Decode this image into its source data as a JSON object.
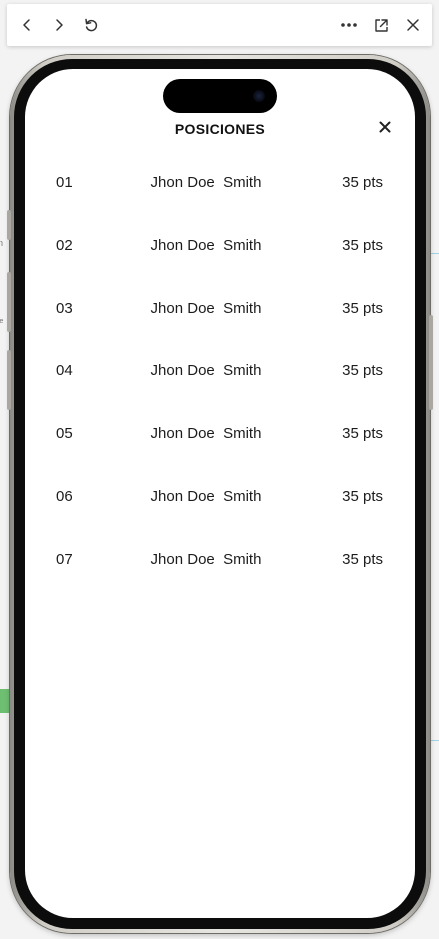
{
  "toolbar": {
    "back_icon": "chevron-left-icon",
    "forward_icon": "chevron-right-icon",
    "reload_icon": "reload-icon",
    "more_icon": "more-dots-icon",
    "open_external_icon": "open-external-icon",
    "close_icon": "close-icon"
  },
  "background": {
    "left_text_1": "n",
    "left_text_2": "le"
  },
  "modal": {
    "title": "POSICIONES",
    "close_icon": "close-icon",
    "rankings": [
      {
        "position": "01",
        "name": "Jhon Doe  Smith",
        "points": "35 pts"
      },
      {
        "position": "02",
        "name": "Jhon Doe  Smith",
        "points": "35 pts"
      },
      {
        "position": "03",
        "name": "Jhon Doe  Smith",
        "points": "35 pts"
      },
      {
        "position": "04",
        "name": "Jhon Doe  Smith",
        "points": "35 pts"
      },
      {
        "position": "05",
        "name": "Jhon Doe  Smith",
        "points": "35 pts"
      },
      {
        "position": "06",
        "name": "Jhon Doe  Smith",
        "points": "35 pts"
      },
      {
        "position": "07",
        "name": "Jhon Doe  Smith",
        "points": "35 pts"
      }
    ]
  },
  "colors": {
    "screen_background": "#ffffff",
    "text": "#1c1c1c",
    "accent_green": "#6fbf73"
  }
}
